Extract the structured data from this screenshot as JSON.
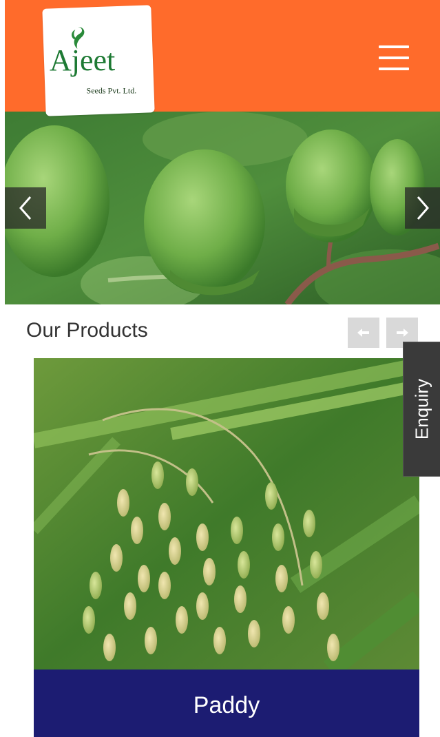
{
  "header": {
    "logo_name": "Ajeet",
    "logo_sub": "Seeds Pvt. Ltd.",
    "menu_icon": "hamburger-menu-icon",
    "bg_color": "#ff6b2b"
  },
  "hero": {
    "prev_icon": "chevron-left-icon",
    "next_icon": "chevron-right-icon"
  },
  "products": {
    "title": "Our Products",
    "prev_icon": "arrow-left-icon",
    "next_icon": "arrow-right-icon",
    "items": [
      {
        "label": "Paddy",
        "label_bg": "#1c1c72"
      }
    ]
  },
  "enquiry": {
    "label": "Enquiry"
  }
}
